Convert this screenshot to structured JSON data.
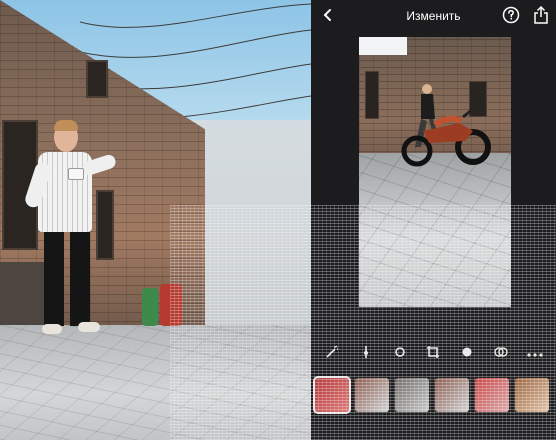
{
  "app": {
    "title": "Изменить",
    "back_icon": "chevron-left-icon",
    "help_icon": "question-circle-icon",
    "share_icon": "share-icon"
  },
  "tools": [
    {
      "icon": "wand-icon"
    },
    {
      "icon": "adjust-icon"
    },
    {
      "icon": "light-icon"
    },
    {
      "icon": "crop-icon"
    },
    {
      "icon": "color-dot-icon"
    },
    {
      "icon": "filters-icon"
    },
    {
      "icon": "more-icon"
    }
  ],
  "filters": [
    {
      "name": "filter-1"
    },
    {
      "name": "filter-2"
    },
    {
      "name": "filter-3"
    },
    {
      "name": "filter-4"
    },
    {
      "name": "filter-5"
    },
    {
      "name": "filter-6"
    }
  ],
  "colors": {
    "panel_bg": "#1c1c1e",
    "text": "#ffffff"
  }
}
